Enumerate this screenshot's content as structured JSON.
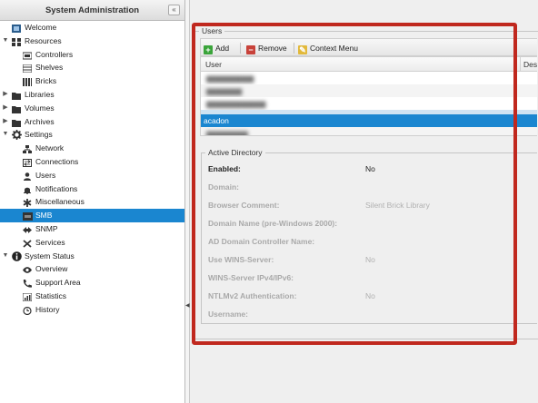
{
  "sidebar": {
    "title": "System Administration",
    "collapse_glyph": "«",
    "items": [
      {
        "label": "Welcome",
        "icon": "welcome-icon"
      },
      {
        "label": "Resources",
        "icon": "resources-icon"
      },
      {
        "label": "Controllers",
        "icon": "controllers-icon"
      },
      {
        "label": "Shelves",
        "icon": "shelves-icon"
      },
      {
        "label": "Bricks",
        "icon": "bricks-icon"
      },
      {
        "label": "Libraries",
        "icon": "folder-icon"
      },
      {
        "label": "Volumes",
        "icon": "folder-icon"
      },
      {
        "label": "Archives",
        "icon": "folder-icon"
      },
      {
        "label": "Settings",
        "icon": "gear-icon"
      },
      {
        "label": "Network",
        "icon": "network-icon"
      },
      {
        "label": "Connections",
        "icon": "connections-icon"
      },
      {
        "label": "Users",
        "icon": "user-icon"
      },
      {
        "label": "Notifications",
        "icon": "bell-icon"
      },
      {
        "label": "Miscellaneous",
        "icon": "asterisk-icon"
      },
      {
        "label": "SMB",
        "icon": "smb-icon"
      },
      {
        "label": "SNMP",
        "icon": "snmp-icon"
      },
      {
        "label": "Services",
        "icon": "tools-icon"
      },
      {
        "label": "System Status",
        "icon": "info-icon"
      },
      {
        "label": "Overview",
        "icon": "eye-icon"
      },
      {
        "label": "Support Area",
        "icon": "phone-icon"
      },
      {
        "label": "Statistics",
        "icon": "chart-icon"
      },
      {
        "label": "History",
        "icon": "clock-icon"
      }
    ]
  },
  "users_panel": {
    "legend": "Users",
    "toolbar": {
      "add_label": "Add",
      "remove_label": "Remove",
      "context_menu_label": "Context Menu"
    },
    "columns": [
      "User",
      "Desc"
    ],
    "selected_user": "acadon"
  },
  "active_directory": {
    "legend": "Active Directory",
    "fields": [
      {
        "label": "Enabled:",
        "value": "No"
      },
      {
        "label": "Domain:",
        "value": ""
      },
      {
        "label": "Browser Comment:",
        "value": "Silent Brick Library"
      },
      {
        "label": "Domain Name (pre-Windows 2000):",
        "value": ""
      },
      {
        "label": "AD Domain Controller Name:",
        "value": ""
      },
      {
        "label": "Use WINS-Server:",
        "value": "No"
      },
      {
        "label": "WINS-Server IPv4/IPv6:",
        "value": ""
      },
      {
        "label": "NTLMv2 Authentication:",
        "value": "No"
      },
      {
        "label": "Username:",
        "value": ""
      }
    ]
  },
  "colors": {
    "selection": "#1a86d0",
    "highlight_box": "#c0281e",
    "add_green": "#3aa43a",
    "remove_red": "#c8423a",
    "context_yellow": "#e2b93b"
  }
}
